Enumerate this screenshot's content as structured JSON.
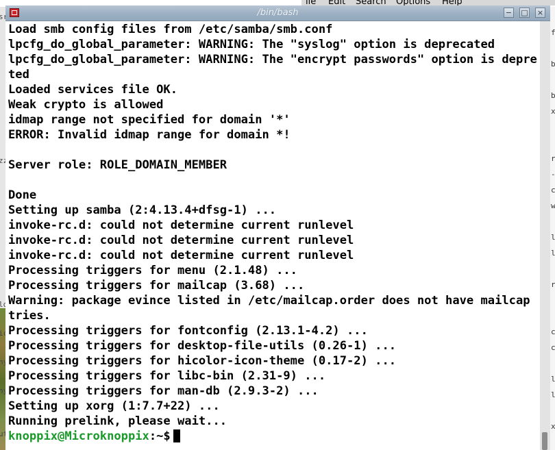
{
  "background_window": {
    "menu": [
      "ile",
      "Edit",
      "Search",
      "Options",
      "Help"
    ],
    "left_edge_chars": [
      "sr",
      "",
      "",
      "",
      "",
      "",
      "",
      "",
      "",
      "",
      "zz",
      "",
      "",
      "",
      "",
      "",
      "",
      "",
      "",
      "",
      "lo",
      "",
      "ic",
      "",
      "ny",
      "",
      "ny",
      "",
      "",
      "ut"
    ],
    "right_edge_chars": [
      "",
      "f",
      "",
      "b",
      "",
      "b",
      "x",
      "",
      "",
      "r",
      "-",
      "c",
      "w",
      "",
      "l",
      "l",
      "",
      "r",
      "",
      "",
      "c",
      "c",
      "",
      "l",
      "l",
      "",
      "x"
    ]
  },
  "terminal": {
    "title": "/bin/bash",
    "buttons": {
      "minimize": "−",
      "maximize": "□",
      "close": "×"
    },
    "lines": [
      "Load smb config files from /etc/samba/smb.conf",
      "lpcfg_do_global_parameter: WARNING: The \"syslog\" option is deprecated",
      "lpcfg_do_global_parameter: WARNING: The \"encrypt passwords\" option is depreca",
      "ted",
      "Loaded services file OK.",
      "Weak crypto is allowed",
      "idmap range not specified for domain '*'",
      "ERROR: Invalid idmap range for domain *!",
      "",
      "Server role: ROLE_DOMAIN_MEMBER",
      "",
      "Done",
      "Setting up samba (2:4.13.4+dfsg-1) ...",
      "invoke-rc.d: could not determine current runlevel",
      "invoke-rc.d: could not determine current runlevel",
      "invoke-rc.d: could not determine current runlevel",
      "Processing triggers for menu (2.1.48) ...",
      "Processing triggers for mailcap (3.68) ...",
      "Warning: package evince listed in /etc/mailcap.order does not have mailcap en",
      "tries.",
      "Processing triggers for fontconfig (2.13.1-4.2) ...",
      "Processing triggers for desktop-file-utils (0.26-1) ...",
      "Processing triggers for hicolor-icon-theme (0.17-2) ...",
      "Processing triggers for libc-bin (2.31-9) ...",
      "Processing triggers for man-db (2.9.3-2) ...",
      "Setting up xorg (1:7.7+22) ...",
      "Running prelink, please wait..."
    ],
    "prompt": {
      "user_host": "knoppix@Microknoppix",
      "path": ":~$"
    },
    "colors": {
      "prompt_user": "#1a9a2a",
      "text": "#000000",
      "background": "#ffffff"
    }
  }
}
